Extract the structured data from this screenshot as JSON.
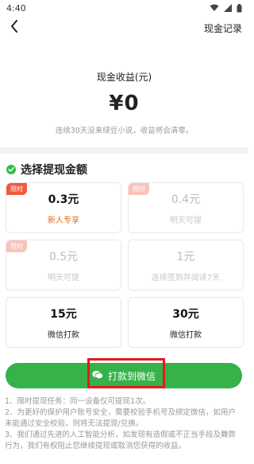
{
  "status": {
    "time": "4:40"
  },
  "header": {
    "record_label": "现金记录"
  },
  "balance": {
    "title": "现金收益(元)",
    "amount": "¥0",
    "note": "连续30天没来绿豆小说，收益将会清零。"
  },
  "section": {
    "title": "选择提现金额"
  },
  "options": [
    {
      "tag": "限时",
      "amount": "0.3元",
      "sub": "新人专享",
      "state": "active"
    },
    {
      "tag": "限时",
      "amount": "0.4元",
      "sub": "明天可提",
      "state": "disabled"
    },
    {
      "tag": "限时",
      "amount": "0.5元",
      "sub": "明天可提",
      "state": "disabled"
    },
    {
      "tag": "",
      "amount": "1元",
      "sub": "连续签到并阅读7天",
      "state": "disabled"
    },
    {
      "tag": "",
      "amount": "15元",
      "sub": "微信打款",
      "state": "normal"
    },
    {
      "tag": "",
      "amount": "30元",
      "sub": "微信打款",
      "state": "normal"
    }
  ],
  "cta": {
    "label": "打款到微信"
  },
  "rules": [
    "1、限时提现任务：同一设备仅可提现1次。",
    "2、为更好的保护用户账号安全，需要校验手机号及绑定微信，如用户未能通过安全校验，则将无法提现/兑换。",
    "3、我们通过先进的人工智能分析，如发现有造假或不正当手段及舞弊行为，我们有权阻止您继续提现或取消您获得的收益。"
  ],
  "colors": {
    "accent": "#35b24a",
    "tag": "#f05a3c",
    "highlight": "#e31b1b"
  }
}
